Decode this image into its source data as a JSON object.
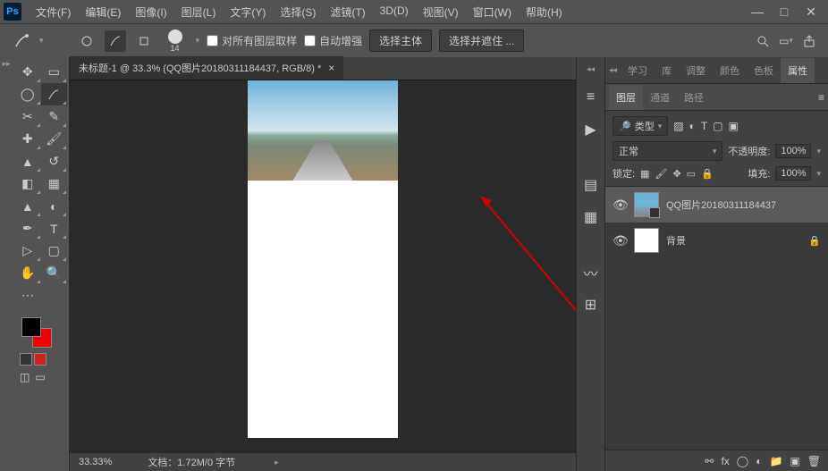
{
  "menu": {
    "file": "文件(F)",
    "edit": "编辑(E)",
    "image": "图像(I)",
    "layer": "图层(L)",
    "type": "文字(Y)",
    "select": "选择(S)",
    "filter": "滤镜(T)",
    "3d": "3D(D)",
    "view": "视图(V)",
    "window": "窗口(W)",
    "help": "帮助(H)"
  },
  "options": {
    "brush_size": "14",
    "sample_all": "对所有图层取样",
    "auto_enhance": "自动增强",
    "select_subject": "选择主体",
    "select_and_mask": "选择并遮住 ..."
  },
  "document": {
    "tab_title": "未标题-1 @ 33.3% (QQ图片20180311184437, RGB/8) *",
    "zoom": "33.33%",
    "info": "文档：1.72M/0 字节"
  },
  "panels": {
    "top_tabs": {
      "learn": "学习",
      "library": "库",
      "adjustments": "调整",
      "color": "颜色",
      "swatches": "色板",
      "properties": "属性"
    },
    "sub_tabs": {
      "layers": "图层",
      "channels": "通道",
      "paths": "路径"
    },
    "filter_kind": "类型",
    "blend_mode": "正常",
    "opacity_label": "不透明度:",
    "opacity_value": "100%",
    "lock_label": "锁定:",
    "fill_label": "填充:",
    "fill_value": "100%",
    "layers": [
      {
        "name": "QQ图片20180311184437",
        "visible": true,
        "selected": true,
        "smart": true,
        "locked": false
      },
      {
        "name": "背景",
        "visible": true,
        "selected": false,
        "smart": false,
        "locked": true
      }
    ]
  }
}
